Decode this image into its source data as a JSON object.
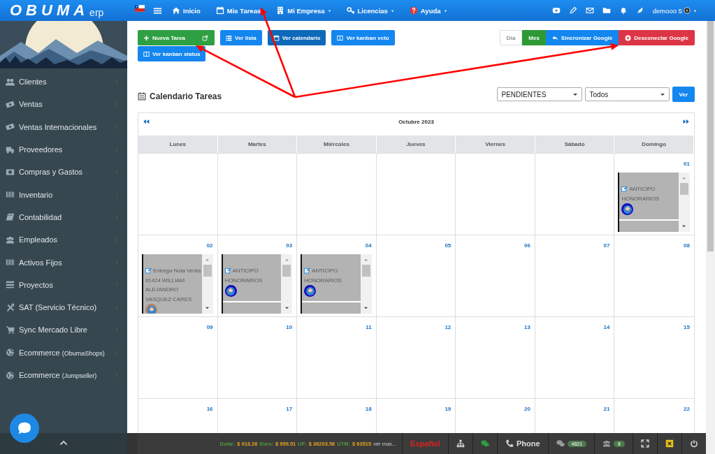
{
  "topbar": {
    "logo": "OBUMA",
    "logo_suffix": "erp",
    "nav": [
      {
        "label": "Inicio",
        "caret": false
      },
      {
        "label": "Mis Tareas",
        "caret": false
      },
      {
        "label": "Mi Empresa",
        "caret": true
      },
      {
        "label": "Licencias",
        "caret": true
      },
      {
        "label": "Ayuda",
        "caret": true
      }
    ],
    "user": "demooo 5"
  },
  "sidebar": {
    "items": [
      {
        "label": "Clientes"
      },
      {
        "label": "Ventas"
      },
      {
        "label": "Ventas Internacionales"
      },
      {
        "label": "Proveedores"
      },
      {
        "label": "Compras y Gastos"
      },
      {
        "label": "Inventario"
      },
      {
        "label": "Contabilidad"
      },
      {
        "label": "Empleados"
      },
      {
        "label": "Activos Fijos"
      },
      {
        "label": "Proyectos"
      },
      {
        "label": "SAT (Servicio Técnico)"
      },
      {
        "label": "Sync Mercado Libre"
      },
      {
        "label": "Ecommerce",
        "suffix": "(ObumaShops)"
      },
      {
        "label": "Ecommerce",
        "suffix": "(Jumpseller)"
      }
    ]
  },
  "toolbar": {
    "new_task": "Nueva Tarea",
    "views": [
      {
        "label": "Ver lista",
        "selected": false
      },
      {
        "label": "Ver calendario",
        "selected": true
      },
      {
        "label": "Ver kanban vcto",
        "selected": false
      },
      {
        "label": "Ver kanban status",
        "selected": false
      }
    ],
    "range": [
      {
        "label": "Día",
        "selected": false
      },
      {
        "label": "Mes",
        "selected": true
      }
    ],
    "google": [
      {
        "label": "Sincronizar Google",
        "kind": "sync"
      },
      {
        "label": "Desconectar Google",
        "kind": "disconnect"
      }
    ]
  },
  "calendar": {
    "title": "Calendario Tareas",
    "status_filter": "PENDIENTES",
    "type_filter": "Todos",
    "apply": "Ver",
    "month": "Octubre 2023",
    "weekdays": [
      "Lunes",
      "Martes",
      "Miércoles",
      "Jueves",
      "Viernes",
      "Sábado",
      "Domingo"
    ],
    "weeks": [
      [
        {
          "date": "01",
          "events": [
            {
              "title": "ANTICIPO HONORARIOS",
              "color": "#1010c0"
            }
          ]
        }
      ],
      [
        {
          "date": "02",
          "events": [
            {
              "title": "Entrega Nota Venta #1424 WILLIAM ALEJANDRO VASQUEZ CARES",
              "color": "#b08468"
            }
          ]
        },
        {
          "date": "03",
          "events": [
            {
              "title": "ANTICIPO HONORARIOS",
              "color": "#1010c0"
            }
          ]
        },
        {
          "date": "04",
          "events": [
            {
              "title": "ANTICIPO HONORARIOS",
              "color": "#1010c0"
            }
          ]
        },
        {
          "date": "05"
        },
        {
          "date": "06"
        },
        {
          "date": "07"
        },
        {
          "date": "08"
        }
      ],
      [
        {
          "date": "09"
        },
        {
          "date": "10"
        },
        {
          "date": "11"
        },
        {
          "date": "12"
        },
        {
          "date": "13"
        },
        {
          "date": "14"
        },
        {
          "date": "15"
        }
      ],
      [
        {
          "date": "16"
        },
        {
          "date": "17"
        },
        {
          "date": "18"
        },
        {
          "date": "19"
        },
        {
          "date": "20"
        },
        {
          "date": "21"
        },
        {
          "date": "22"
        }
      ]
    ]
  },
  "status_bar": {
    "rates": [
      {
        "label": "Dolar:",
        "value": "$ 913.26"
      },
      {
        "label": "Euro:",
        "value": "$ 959.51"
      },
      {
        "label": "UF:",
        "value": "$ 36203.56"
      },
      {
        "label": "UTM:",
        "value": "$ 63515"
      }
    ],
    "more": "ver mas...",
    "language": "Español",
    "phone": "Phone",
    "messages": "4821",
    "users": "6"
  }
}
